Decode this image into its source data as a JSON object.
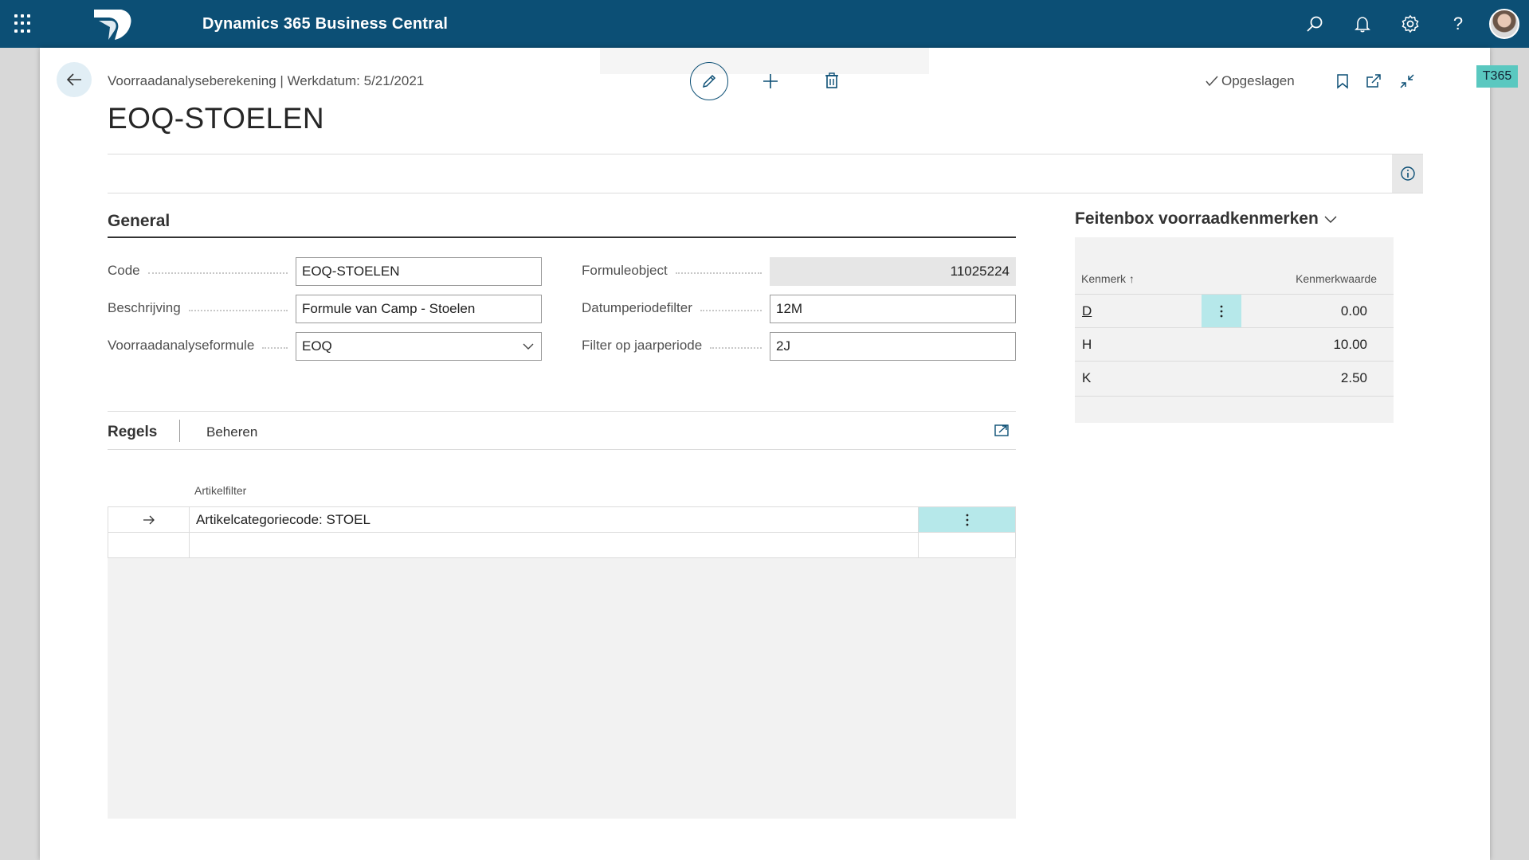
{
  "app": {
    "title": "Dynamics 365 Business Central"
  },
  "header": {
    "breadcrumb": "Voorraadanalyseberekening | Werkdatum: 5/21/2021",
    "title": "EOQ-STOELEN",
    "saved_label": "Opgeslagen",
    "env_badge": "T365"
  },
  "general": {
    "section_title": "General",
    "fields": {
      "code": {
        "label": "Code",
        "value": "EOQ-STOELEN"
      },
      "beschrijving": {
        "label": "Beschrijving",
        "value": "Formule van Camp - Stoelen"
      },
      "formule": {
        "label": "Voorraadanalyseformule",
        "value": "EOQ"
      },
      "formuleobject": {
        "label": "Formuleobject",
        "value": "11025224"
      },
      "datumperiodefilter": {
        "label": "Datumperiodefilter",
        "value": "12M"
      },
      "jaarperiode": {
        "label": "Filter op jaarperiode",
        "value": "2J"
      }
    }
  },
  "regels": {
    "title": "Regels",
    "manage_label": "Beheren",
    "column_header": "Artikelfilter",
    "rows": [
      {
        "filter": "Artikelcategoriecode: STOEL"
      },
      {
        "filter": ""
      }
    ]
  },
  "factbox": {
    "title": "Feitenbox voorraadkenmerken",
    "col_key": "Kenmerk ↑",
    "col_value": "Kenmerkwaarde",
    "rows": [
      {
        "key": "D",
        "value": "0.00"
      },
      {
        "key": "H",
        "value": "10.00"
      },
      {
        "key": "K",
        "value": "2.50"
      }
    ]
  },
  "colors": {
    "appbar": "#0c4f75",
    "accent_teal": "#b6e8ea",
    "badge": "#5ac8c0"
  }
}
